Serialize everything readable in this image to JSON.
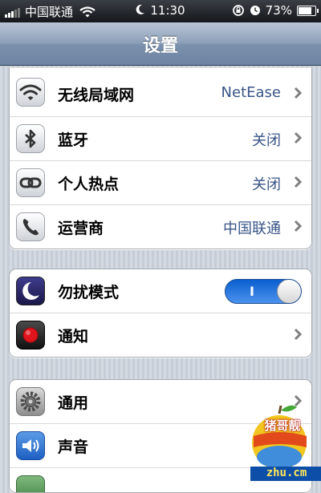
{
  "status_bar": {
    "carrier": "中国联通",
    "time": "11:30",
    "battery_text": "73%",
    "battery_level": 0.73,
    "signal_bars_filled": 3,
    "signal_bars_total": 5
  },
  "nav": {
    "title": "设置"
  },
  "groups": [
    {
      "rows": [
        {
          "label": "无线局域网",
          "value": "NetEase",
          "icon": "wifi-icon"
        },
        {
          "label": "蓝牙",
          "value": "关闭",
          "icon": "bluetooth-icon"
        },
        {
          "label": "个人热点",
          "value": "关闭",
          "icon": "hotspot-icon"
        },
        {
          "label": "运营商",
          "value": "中国联通",
          "icon": "phone-icon"
        }
      ]
    },
    {
      "rows": [
        {
          "label": "勿扰模式",
          "toggle_state": "I",
          "icon": "moon-icon"
        },
        {
          "label": "通知",
          "icon": "notifications-icon"
        }
      ]
    },
    {
      "rows": [
        {
          "label": "通用",
          "icon": "gear-icon"
        },
        {
          "label": "声音",
          "icon": "speaker-icon"
        }
      ]
    }
  ],
  "watermark": {
    "badge_text": "猪哥靓",
    "site_text": "zhu.cm"
  },
  "colors": {
    "value_text": "#385487",
    "nav_bar": "#7c91ad",
    "toggle_on": "#1f6fd8",
    "background": "#cbd2dc"
  }
}
